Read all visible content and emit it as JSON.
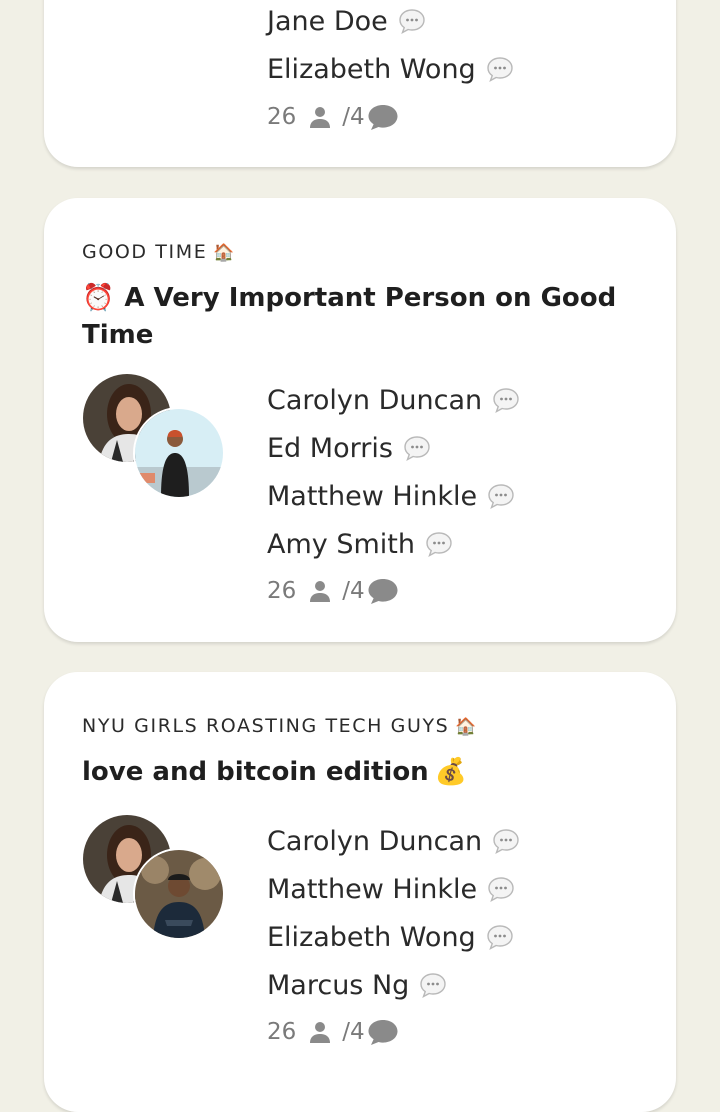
{
  "cards": [
    {
      "speakers": [
        "Jane Doe",
        "Elizabeth Wong"
      ],
      "listeners": "26",
      "speakers_count": "4"
    },
    {
      "club": "GOOD TIME",
      "club_icon": "house-emoji",
      "title_icon": "alarm-clock-emoji",
      "title": "A Very Important Person on Good Time",
      "speakers": [
        "Carolyn Duncan",
        "Ed Morris",
        "Matthew Hinkle",
        "Amy Smith"
      ],
      "listeners": "26",
      "speakers_count": "4"
    },
    {
      "club": "NYU GIRLS ROASTING TECH GUYS",
      "club_icon": "house-emoji",
      "title": "love and bitcoin edition",
      "title_icon": "money-bag-emoji",
      "speakers": [
        "Carolyn Duncan",
        "Matthew Hinkle",
        "Elizabeth Wong",
        "Marcus Ng"
      ],
      "listeners": "26",
      "speakers_count": "4"
    }
  ],
  "emoji": {
    "house": "🏠",
    "alarm": "⏰",
    "money_bag": "💰"
  },
  "colors": {
    "background": "#f1f0e6",
    "card": "#ffffff",
    "stats": "#7a7a7a",
    "icon_gray": "#8a8a8a"
  }
}
